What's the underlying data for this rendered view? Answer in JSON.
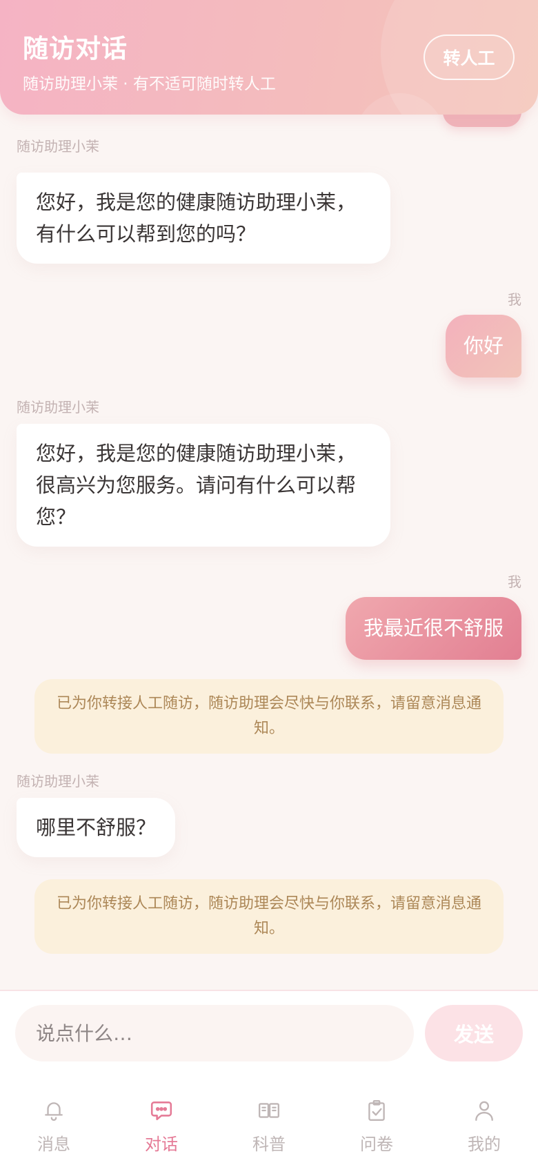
{
  "header": {
    "title": "随访对话",
    "subtitle": "随访助理小茉 · 有不适可随时转人工",
    "transfer_label": "转人工"
  },
  "messages": [
    {
      "role": "bot",
      "sender": "随访助理小茉",
      "text": "您好，我是您的健康随访助理小茉，有什么可以帮到您的吗？"
    },
    {
      "role": "me",
      "sender": "我",
      "text": "你好"
    },
    {
      "role": "bot",
      "sender": "随访助理小茉",
      "text": "您好，我是您的健康随访助理小茉，很高兴为您服务。请问有什么可以帮您？"
    },
    {
      "role": "me",
      "sender": "我",
      "text": "我最近很不舒服"
    },
    {
      "role": "notice",
      "text": "已为你转接人工随访，随访助理会尽快与你联系，请留意消息通知。"
    },
    {
      "role": "bot",
      "sender": "随访助理小茉",
      "text": "哪里不舒服？"
    },
    {
      "role": "notice",
      "text": "已为你转接人工随访，随访助理会尽快与你联系，请留意消息通知。"
    }
  ],
  "input": {
    "placeholder": "说点什么…",
    "send_label": "发送"
  },
  "tabs": [
    {
      "label": "消息",
      "icon": "bell-icon",
      "active": false
    },
    {
      "label": "对话",
      "icon": "chat-bubble-icon",
      "active": true
    },
    {
      "label": "科普",
      "icon": "book-icon",
      "active": false
    },
    {
      "label": "问卷",
      "icon": "clipboard-check-icon",
      "active": false
    },
    {
      "label": "我的",
      "icon": "person-icon",
      "active": false
    }
  ],
  "colors": {
    "header_gradient_start": "#f5b3c4",
    "header_gradient_end": "#f4c5b8",
    "accent": "#e57a96",
    "notice_bg": "#fbf0dc",
    "notice_text": "#ac8757"
  }
}
